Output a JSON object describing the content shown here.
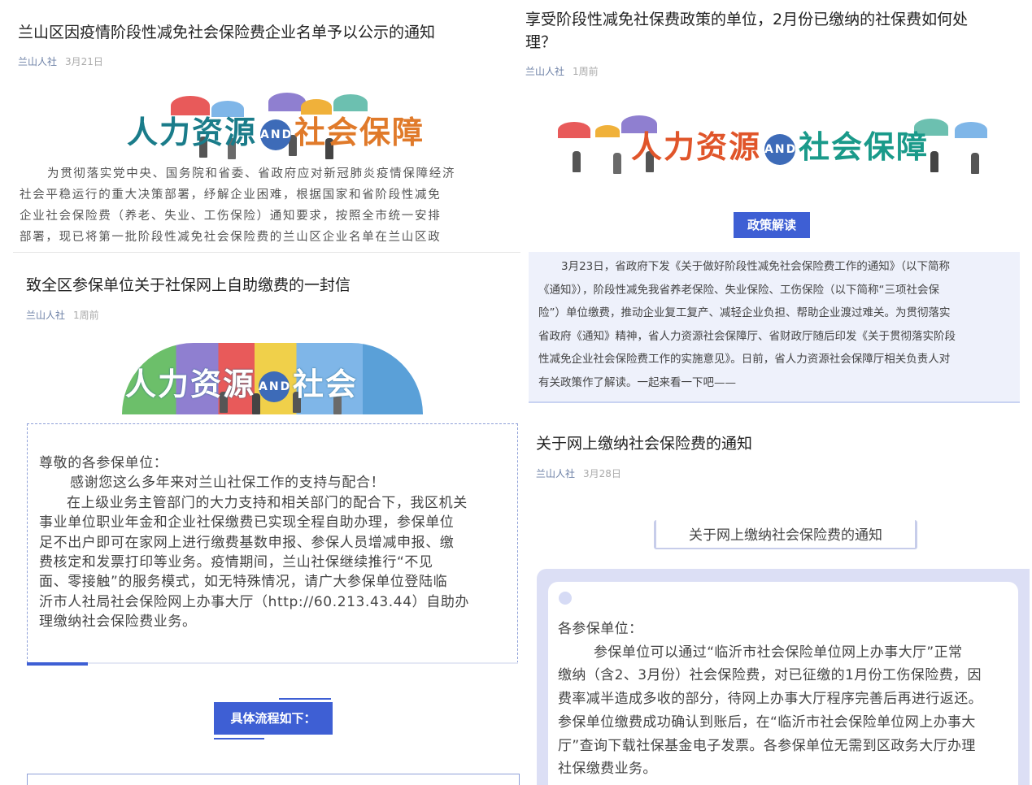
{
  "card1": {
    "title": "兰山区因疫情阶段性减免社会保险费企业名单予以公示的通知",
    "source": "兰山人社",
    "date": "3月21日",
    "banner": {
      "p1": "人力资源",
      "and": "AND",
      "p2": "社会保障"
    },
    "body_lines": [
      "为贯彻落实党中央、国务院和省委、省政府应对新冠肺炎疫情保障经济",
      "社会平稳运行的重大决策部署，纾解企业困难，根据国家和省阶段性减免",
      "企业社会保险费（养老、失业、工伤保险）通知要求，按照全市统一安排",
      "部署，现已将第一批阶段性减免社会保险费的兰山区企业名单在兰山区政"
    ]
  },
  "card2": {
    "title_line1": "享受阶段性减免社保费政策的单位，2月份已缴纳的社保费如何处",
    "title_line2": "理？",
    "source": "兰山人社",
    "date": "1周前",
    "banner": {
      "p1": "人力资源",
      "and": "AND",
      "p2": "社会保障"
    },
    "button": "政策解读",
    "body_lines": [
      "3月23日，省政府下发《关于做好阶段性减免社会保险费工作的通知》（以下简称",
      "《通知》），阶段性减免我省养老保险、失业保险、工伤保险（以下简称“三项社会保",
      "险”）单位缴费，推动企业复工复产、减轻企业负担、帮助企业渡过难关。为贯彻落实",
      "省政府《通知》精神，省人力资源社会保障厅、省财政厅随后印发《关于贯彻落实阶段",
      "性减免企业社会保险费工作的实施意见》。日前，省人力资源社会保障厅相关负责人对",
      "有关政策作了解读。一起来看一下吧——"
    ]
  },
  "card3": {
    "title": "致全区参保单位关于社保网上自助缴费的一封信",
    "source": "兰山人社",
    "date": "1周前",
    "banner": {
      "p1": "人力资源",
      "and": "AND",
      "p2": "社会"
    },
    "greeting": "尊敬的各参保单位：",
    "thanks": "感谢您这么多年来对兰山社保工作的支持与配合！",
    "body_lines": [
      "在上级业务主管部门的大力支持和相关部门的配合下，我区机关",
      "事业单位职业年金和企业社保缴费已实现全程自助办理，参保单位",
      "足不出户即可在家网上进行缴费基数申报、参保人员增减申报、缴",
      "费核定和发票打印等业务。疫情期间，兰山社保继续推行“不见",
      "面、零接触”的服务模式，如无特殊情况，请广大参保单位登陆临",
      "沂市人社局社会保险网上办事大厅（http://60.213.43.44）自助办",
      "理缴纳社会保险费业务。"
    ],
    "button": "具体流程如下："
  },
  "card4": {
    "title": "关于网上缴纳社会保险费的通知",
    "source": "兰山人社",
    "date": "3月28日",
    "heading": "关于网上缴纳社会保险费的通知",
    "greeting": "各参保单位：",
    "body_lines": [
      "参保单位可以通过“临沂市社会保险单位网上办事大厅”正常",
      "缴纳（含2、3月份）社会保险费，对已征缴的1月份工伤保险费，因",
      "费率减半造成多收的部分，待网上办事大厅程序完善后再进行返还。",
      "参保单位缴费成功确认到账后，在“临沂市社会保险单位网上办事大",
      "厅”查询下载社保基金电子发票。各参保单位无需到区政务大厅办理",
      "社保缴费业务。"
    ]
  },
  "colors": {
    "accent_blue": "#3e5fd4",
    "meta_blue": "#6b7fa5",
    "panel_bg": "#eef1fb"
  }
}
